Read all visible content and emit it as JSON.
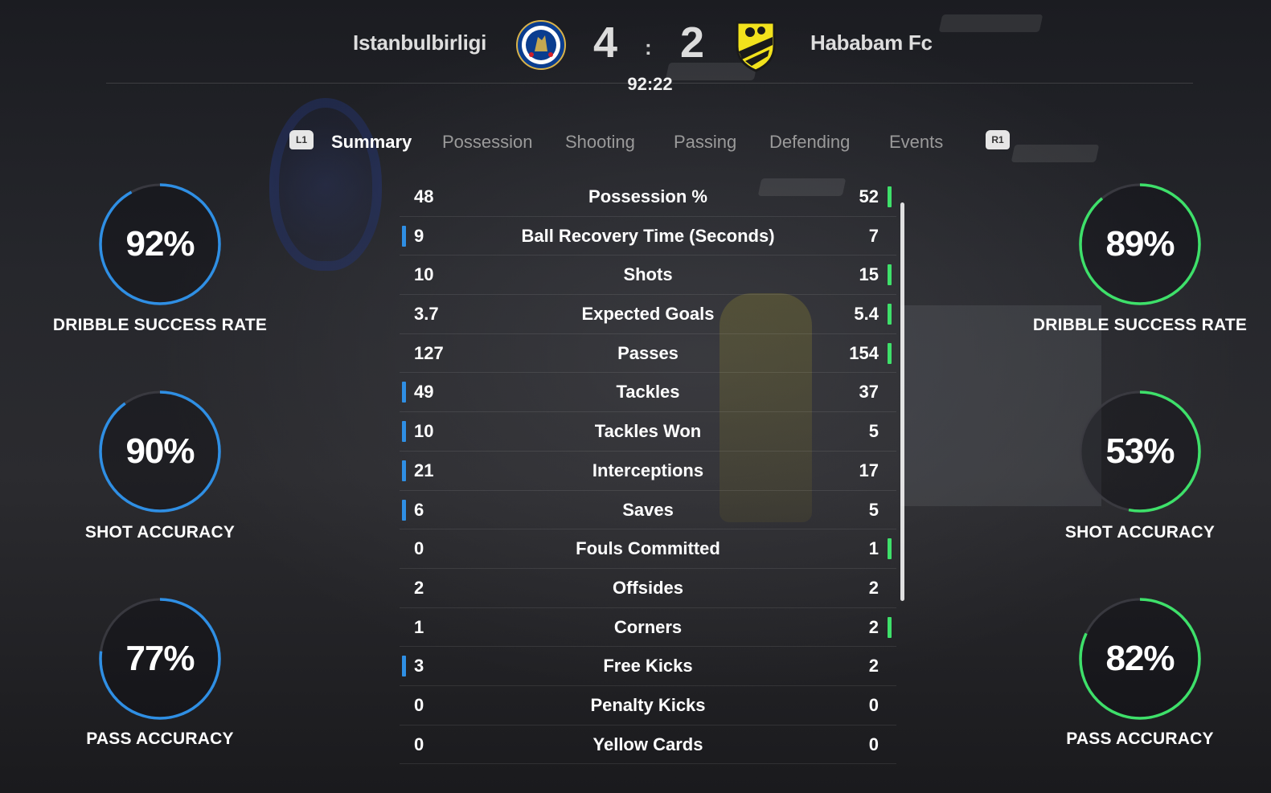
{
  "match": {
    "home_team": "Istanbulbirligi",
    "away_team": "Hababam Fc",
    "home_score": "4",
    "separator": ":",
    "away_score": "2",
    "clock": "92:22",
    "home_crest_icon": "chelsea-crest-icon",
    "away_crest_icon": "hababam-shield-icon"
  },
  "tabs": {
    "prev_button": "L1",
    "next_button": "R1",
    "items": [
      "Summary",
      "Possession",
      "Shooting",
      "Passing",
      "Defending",
      "Events"
    ],
    "active": "Summary"
  },
  "gauges": {
    "home": [
      {
        "value": "92%",
        "label": "DRIBBLE SUCCESS RATE",
        "fraction": 0.92
      },
      {
        "value": "90%",
        "label": "SHOT ACCURACY",
        "fraction": 0.9
      },
      {
        "value": "77%",
        "label": "PASS ACCURACY",
        "fraction": 0.77
      }
    ],
    "away": [
      {
        "value": "89%",
        "label": "DRIBBLE SUCCESS RATE",
        "fraction": 0.89
      },
      {
        "value": "53%",
        "label": "SHOT ACCURACY",
        "fraction": 0.53
      },
      {
        "value": "82%",
        "label": "PASS ACCURACY",
        "fraction": 0.82
      }
    ]
  },
  "colors": {
    "home_accent": "#2f8fe4",
    "away_accent": "#3ee06a"
  },
  "stats": [
    {
      "home": "48",
      "label": "Possession %",
      "away": "52",
      "leader": "away"
    },
    {
      "home": "9",
      "label": "Ball Recovery Time (Seconds)",
      "away": "7",
      "leader": "home"
    },
    {
      "home": "10",
      "label": "Shots",
      "away": "15",
      "leader": "away"
    },
    {
      "home": "3.7",
      "label": "Expected Goals",
      "away": "5.4",
      "leader": "away"
    },
    {
      "home": "127",
      "label": "Passes",
      "away": "154",
      "leader": "away"
    },
    {
      "home": "49",
      "label": "Tackles",
      "away": "37",
      "leader": "home"
    },
    {
      "home": "10",
      "label": "Tackles Won",
      "away": "5",
      "leader": "home"
    },
    {
      "home": "21",
      "label": "Interceptions",
      "away": "17",
      "leader": "home"
    },
    {
      "home": "6",
      "label": "Saves",
      "away": "5",
      "leader": "home"
    },
    {
      "home": "0",
      "label": "Fouls Committed",
      "away": "1",
      "leader": "away"
    },
    {
      "home": "2",
      "label": "Offsides",
      "away": "2",
      "leader": "none"
    },
    {
      "home": "1",
      "label": "Corners",
      "away": "2",
      "leader": "away"
    },
    {
      "home": "3",
      "label": "Free Kicks",
      "away": "2",
      "leader": "home"
    },
    {
      "home": "0",
      "label": "Penalty Kicks",
      "away": "0",
      "leader": "none"
    },
    {
      "home": "0",
      "label": "Yellow Cards",
      "away": "0",
      "leader": "none"
    }
  ]
}
